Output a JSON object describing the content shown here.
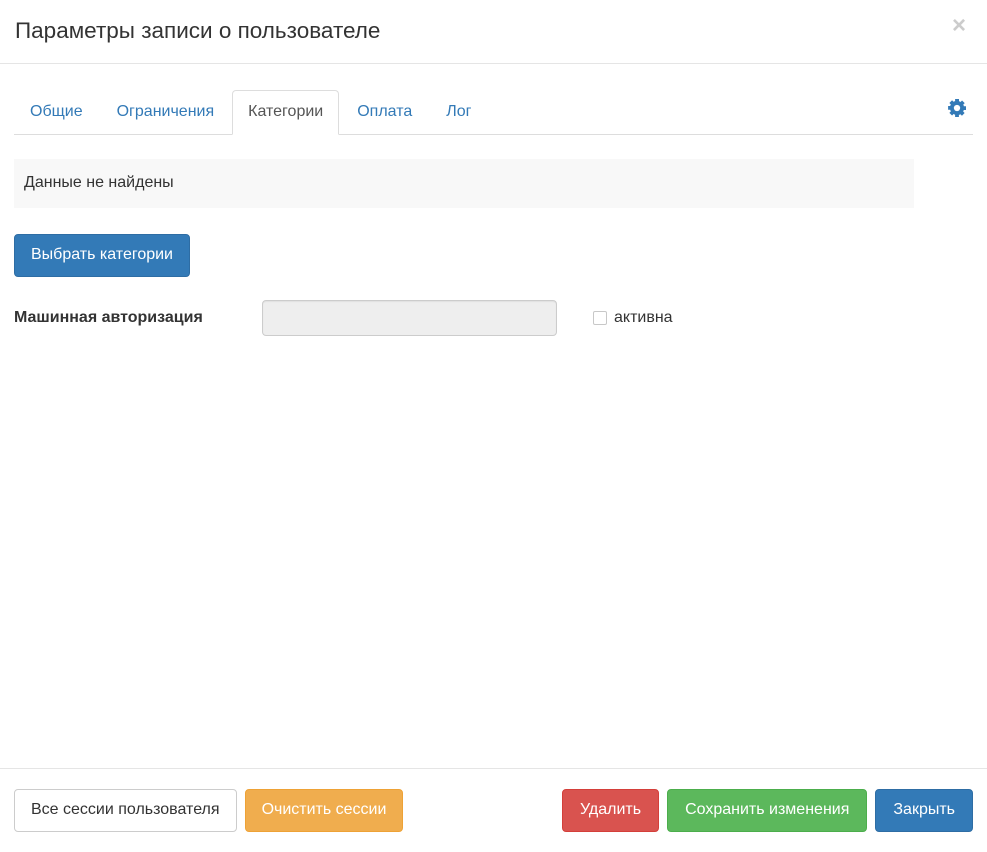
{
  "dialog": {
    "title": "Параметры записи о пользователе",
    "close_label": "×",
    "close_icon": "close-icon"
  },
  "tabs": {
    "items": [
      {
        "label": "Общие",
        "active": false
      },
      {
        "label": "Ограничения",
        "active": false
      },
      {
        "label": "Категории",
        "active": true
      },
      {
        "label": "Оплата",
        "active": false
      },
      {
        "label": "Лог",
        "active": false
      }
    ],
    "settings_icon": "gear-icon"
  },
  "content": {
    "empty_message": "Данные не найдены",
    "choose_categories_label": "Выбрать категории",
    "machine_auth": {
      "label": "Машинная авторизация",
      "value": "",
      "placeholder": "",
      "checkbox_label": "активна",
      "checked": false
    }
  },
  "footer": {
    "all_sessions_label": "Все сессии пользователя",
    "clear_sessions_label": "Очистить сессии",
    "delete_label": "Удалить",
    "save_label": "Сохранить изменения",
    "close_label": "Закрыть"
  },
  "colors": {
    "primary": "#337ab7",
    "warning": "#f0ad4e",
    "danger": "#d9534f",
    "success": "#5cb85c",
    "panel_bg": "#f8f8f8",
    "border": "#dddddd"
  }
}
